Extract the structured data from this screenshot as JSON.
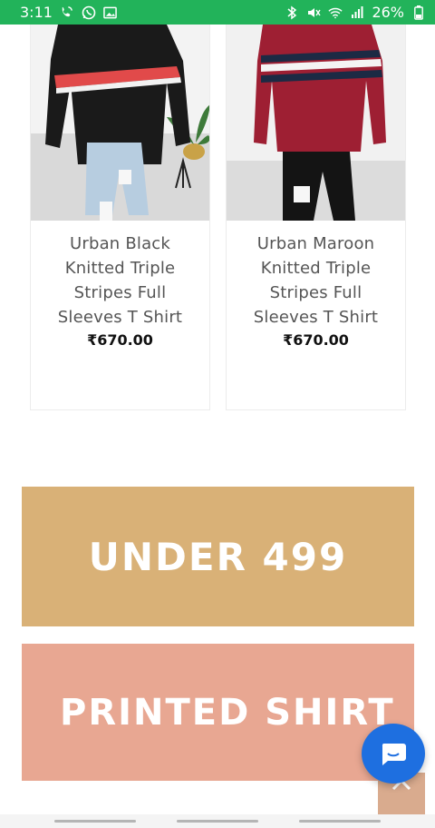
{
  "status_bar": {
    "time": "3:11",
    "battery": "26%",
    "icons_left": [
      "wifi-call-icon",
      "whatsapp-icon",
      "image-icon"
    ],
    "icons_right": [
      "bluetooth-icon",
      "mute-icon",
      "wifi-icon",
      "signal-icon",
      "battery-icon"
    ]
  },
  "products": [
    {
      "title_lines": [
        "Urban Black",
        "Knitted Triple",
        "Stripes Full",
        "Sleeves T Shirt"
      ],
      "price": "₹670.00",
      "shirt_color": "#1a1a1a",
      "stripe_color": "#e14a4a"
    },
    {
      "title_lines": [
        "Urban Maroon",
        "Knitted Triple",
        "Stripes Full",
        "Sleeves T Shirt"
      ],
      "price": "₹670.00",
      "shirt_color": "#9e1f33",
      "stripe_color": "#1c2a44"
    }
  ],
  "banners": {
    "under": "UNDER 499",
    "printed": "PRINTED SHIRT"
  },
  "colors": {
    "status_green": "#22b35a",
    "under_bg": "#d9b177",
    "printed_bg": "#e8a792",
    "chat_blue": "#1e6fe0",
    "scroll_top_bg": "#d9ab8e"
  }
}
